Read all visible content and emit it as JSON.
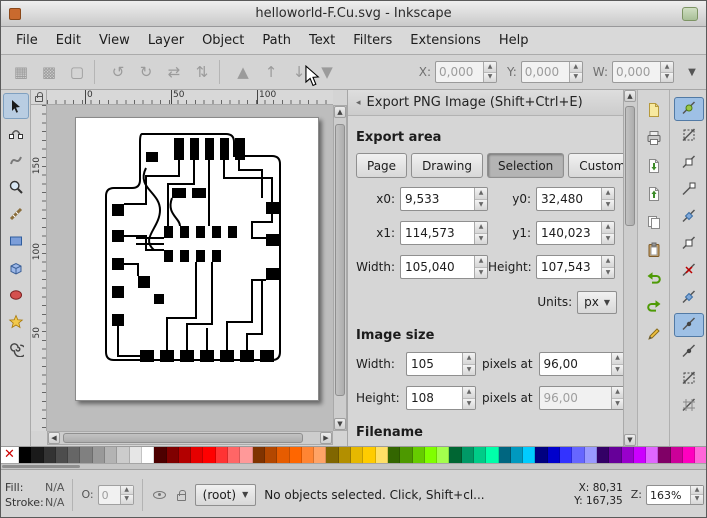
{
  "window": {
    "title": "helloworld-F.Cu.svg - Inkscape"
  },
  "menu": {
    "items": [
      "File",
      "Edit",
      "View",
      "Layer",
      "Object",
      "Path",
      "Text",
      "Filters",
      "Extensions",
      "Help"
    ]
  },
  "command_toolbar": {
    "x_label": "X:",
    "x_value": "0,000",
    "y_label": "Y:",
    "y_value": "0,000",
    "w_label": "W:",
    "w_value": "0,000"
  },
  "rulers": {
    "h_ticks": [
      "0",
      "50",
      "100"
    ],
    "v_ticks": [
      "150",
      "100",
      "50"
    ]
  },
  "tools": [
    "selector",
    "node-editor",
    "tweak",
    "zoom",
    "measure",
    "rectangle",
    "3d-box",
    "ellipse",
    "star",
    "spiral"
  ],
  "export_panel": {
    "title": "Export PNG Image (Shift+Ctrl+E)",
    "export_area": {
      "heading": "Export area",
      "buttons": [
        "Page",
        "Drawing",
        "Selection",
        "Custom"
      ],
      "active_button": "Selection",
      "x0_label": "x0:",
      "x0": "9,533",
      "y0_label": "y0:",
      "y0": "32,480",
      "x1_label": "x1:",
      "x1": "114,573",
      "y1_label": "y1:",
      "y1": "140,023",
      "width_label": "Width:",
      "width": "105,040",
      "height_label": "Height:",
      "height": "107,543",
      "units_label": "Units:",
      "units": "px"
    },
    "image_size": {
      "heading": "Image size",
      "width_label": "Width:",
      "width": "105",
      "height_label": "Height:",
      "height": "108",
      "pixels_at": "pixels at",
      "dpi_width": "96,00",
      "dpi_height": "96,00"
    },
    "filename_heading": "Filename"
  },
  "right_toolbars": {
    "commands": [
      "new-document",
      "print",
      "import",
      "export",
      "copy",
      "paste",
      "undo",
      "redo",
      "edit"
    ],
    "snap": [
      "snap-master",
      "snap-bbox",
      "snap-bbox-edges",
      "snap-bbox-corners",
      "snap-nodes",
      "snap-paths",
      "snap-intersections",
      "snap-cusp-nodes",
      "snap-midpoints",
      "snap-centers",
      "snap-page-border",
      "snap-grids"
    ],
    "snap_active": [
      0,
      8
    ]
  },
  "palette": {
    "colors": [
      "none",
      "#000000",
      "#1a1a1a",
      "#333333",
      "#4d4d4d",
      "#666666",
      "#808080",
      "#999999",
      "#b3b3b3",
      "#cccccc",
      "#e6e6e6",
      "#ffffff",
      "#4d0000",
      "#800000",
      "#b30000",
      "#e60000",
      "#ff0000",
      "#ff3333",
      "#ff6666",
      "#ff9999",
      "#803300",
      "#b34700",
      "#e65c00",
      "#ff6600",
      "#ff8533",
      "#ffa366",
      "#806600",
      "#b38f00",
      "#e6b800",
      "#ffcc00",
      "#ffe066",
      "#336600",
      "#4d9900",
      "#66cc00",
      "#80ff00",
      "#a3ff4d",
      "#006633",
      "#009966",
      "#00cc88",
      "#00ffaa",
      "#006680",
      "#0099bf",
      "#00ccff",
      "#000080",
      "#0000cc",
      "#3333ff",
      "#6666ff",
      "#9999ff",
      "#330066",
      "#660099",
      "#9900cc",
      "#cc00ff",
      "#e066ff",
      "#800066",
      "#cc0099",
      "#ff00bf",
      "#ff66d9"
    ]
  },
  "statusbar": {
    "fill_label": "Fill:",
    "fill_value": "N/A",
    "stroke_label": "Stroke:",
    "stroke_value": "N/A",
    "opacity_label": "O:",
    "opacity_value": "0",
    "layer_value": "(root)",
    "message": "No objects selected. Click, Shift+cl...",
    "x_label": "X:",
    "x_value": "80,31",
    "y_label": "Y:",
    "y_value": "167,35",
    "zoom_label": "Z:",
    "zoom_value": "163%"
  }
}
